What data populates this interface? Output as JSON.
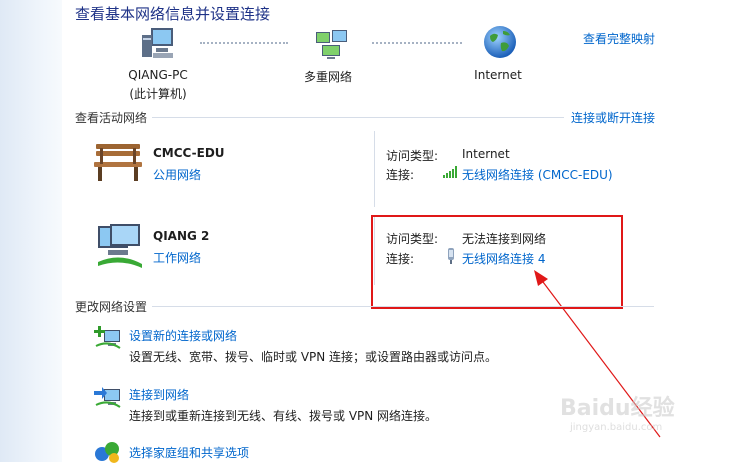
{
  "header": {
    "title": "查看基本网络信息并设置连接",
    "full_map_link": "查看完整映射"
  },
  "map": {
    "nodes": [
      {
        "label_line1": "QIANG-PC",
        "label_line2": "(此计算机)",
        "icon": "computer-icon"
      },
      {
        "label_line1": "多重网络",
        "icon": "network-icon"
      },
      {
        "label_line1": "Internet",
        "icon": "globe-icon"
      }
    ]
  },
  "active": {
    "heading": "查看活动网络",
    "connect_link": "连接或断开连接",
    "networks": [
      {
        "name": "CMCC-EDU",
        "type": "公用网络",
        "icon": "bench-icon",
        "access_label": "访问类型:",
        "access_value": "Internet",
        "conn_label": "连接:",
        "conn_value": "无线网络连接 (CMCC-EDU)",
        "conn_icon": "signal-bars-icon"
      },
      {
        "name": "QIANG  2",
        "type": "工作网络",
        "icon": "work-network-icon",
        "access_label": "访问类型:",
        "access_value": "无法连接到网络",
        "conn_label": "连接:",
        "conn_value": "无线网络连接 4",
        "conn_icon": "adapter-icon"
      }
    ]
  },
  "change": {
    "heading": "更改网络设置",
    "tasks": [
      {
        "title": "设置新的连接或网络",
        "desc": "设置无线、宽带、拨号、临时或 VPN 连接；或设置路由器或访问点。",
        "icon": "new-connection-icon"
      },
      {
        "title": "连接到网络",
        "desc": "连接到或重新连接到无线、有线、拨号或 VPN 网络连接。",
        "icon": "connect-network-icon"
      },
      {
        "title": "选择家庭组和共享选项",
        "icon": "homegroup-icon"
      }
    ]
  },
  "colors": {
    "link": "#0066cc",
    "title": "#1e3287",
    "annotation": "#e01818"
  },
  "watermark": {
    "text": "Baidu经验",
    "sub": "jingyan.baidu.com"
  }
}
